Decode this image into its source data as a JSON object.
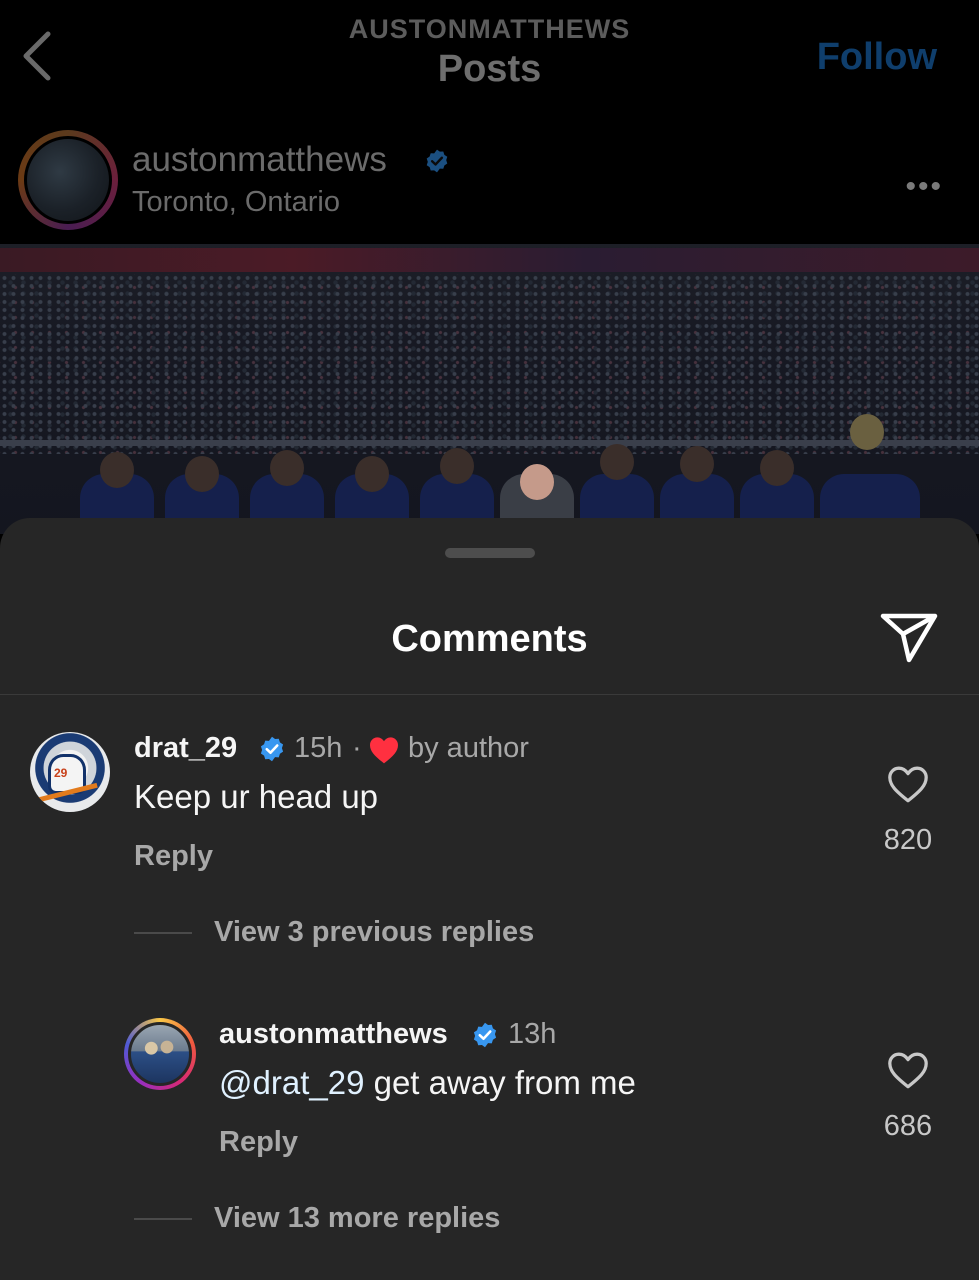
{
  "header": {
    "account_caps": "AUSTONMATTHEWS",
    "title": "Posts",
    "follow_label": "Follow"
  },
  "post": {
    "username": "austonmatthews",
    "location": "Toronto, Ontario",
    "more_label": "•••"
  },
  "sheet": {
    "title": "Comments"
  },
  "comments": [
    {
      "username": "drat_29",
      "time": "15h",
      "separator": "·",
      "liked_by_author": "by author",
      "text": "Keep ur head up",
      "reply_label": "Reply",
      "likes": "820"
    },
    {
      "username": "austonmatthews",
      "time": "13h",
      "mention": "@drat_29",
      "text": " get away from me",
      "reply_label": "Reply",
      "likes": "686"
    }
  ],
  "thread": {
    "view_previous": "View 3 previous replies",
    "view_more": "View 13 more replies"
  },
  "colors": {
    "background": "#000000",
    "sheet": "#262626",
    "verified": "#3897f0",
    "heart_red": "#ff3040",
    "follow_dimmed": "#0f3e6c"
  },
  "icons": [
    "back-chevron-icon",
    "verified-badge-icon",
    "more-icon",
    "share-send-icon",
    "heart-icon",
    "liked-heart-icon"
  ]
}
